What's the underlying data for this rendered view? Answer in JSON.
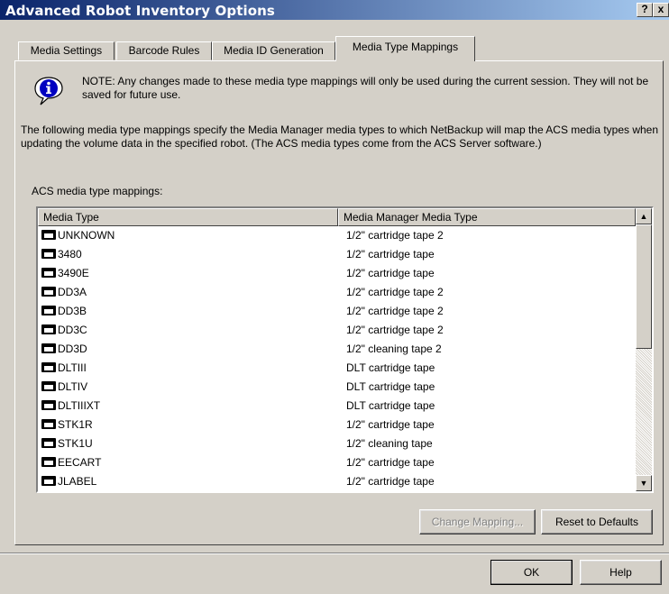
{
  "window": {
    "title": "Advanced Robot Inventory Options",
    "help_glyph": "?",
    "close_glyph": "x"
  },
  "tabs": [
    {
      "label": "Media Settings",
      "active": false
    },
    {
      "label": "Barcode Rules",
      "active": false
    },
    {
      "label": "Media ID Generation",
      "active": false
    },
    {
      "label": "Media Type Mappings",
      "active": true
    }
  ],
  "note": {
    "icon": "info-icon",
    "text": "NOTE: Any changes made to these media type mappings will only be used during the current session. They will not be saved for future use."
  },
  "description": "The following media type mappings specify the Media Manager media types to which NetBackup will map the ACS media types when updating the volume data in the specified robot. (The ACS media types come from the ACS Server software.)",
  "list": {
    "label": "ACS media type mappings:",
    "columns": [
      "Media Type",
      "Media Manager Media Type"
    ],
    "rows": [
      {
        "media_type": "UNKNOWN",
        "mm_type": "1/2\" cartridge tape 2"
      },
      {
        "media_type": "3480",
        "mm_type": "1/2\" cartridge tape"
      },
      {
        "media_type": "3490E",
        "mm_type": "1/2\" cartridge tape"
      },
      {
        "media_type": "DD3A",
        "mm_type": "1/2\" cartridge tape 2"
      },
      {
        "media_type": "DD3B",
        "mm_type": "1/2\" cartridge tape 2"
      },
      {
        "media_type": "DD3C",
        "mm_type": "1/2\" cartridge tape 2"
      },
      {
        "media_type": "DD3D",
        "mm_type": "1/2\" cleaning tape 2"
      },
      {
        "media_type": "DLTIII",
        "mm_type": "DLT cartridge tape"
      },
      {
        "media_type": "DLTIV",
        "mm_type": "DLT cartridge tape"
      },
      {
        "media_type": "DLTIIIXT",
        "mm_type": "DLT cartridge tape"
      },
      {
        "media_type": "STK1R",
        "mm_type": "1/2\" cartridge tape"
      },
      {
        "media_type": "STK1U",
        "mm_type": "1/2\" cleaning tape"
      },
      {
        "media_type": "EECART",
        "mm_type": "1/2\" cartridge tape"
      },
      {
        "media_type": "JLABEL",
        "mm_type": "1/2\" cartridge tape"
      }
    ]
  },
  "buttons": {
    "change_mapping": "Change Mapping...",
    "reset_defaults": "Reset to Defaults",
    "ok": "OK",
    "help": "Help"
  }
}
